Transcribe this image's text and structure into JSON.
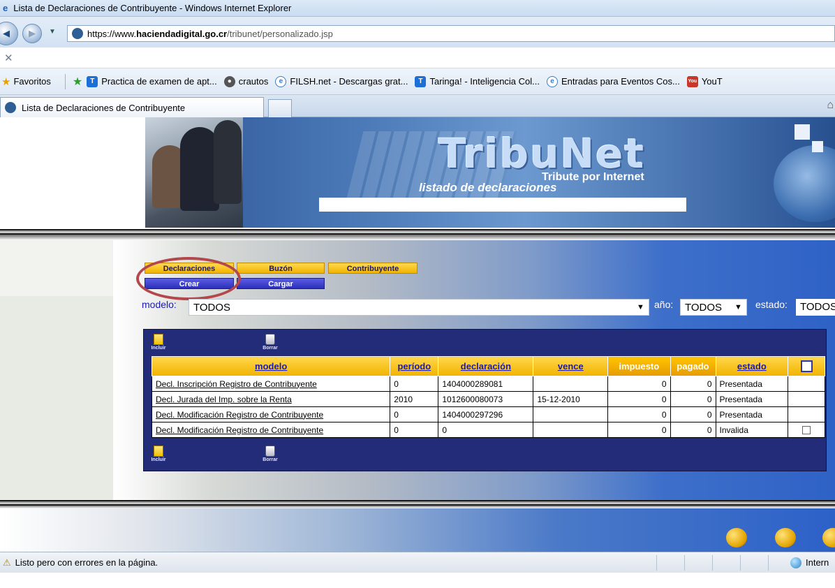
{
  "window": {
    "title": "Lista de Declaraciones de Contribuyente - Windows Internet Explorer"
  },
  "address_bar": {
    "scheme": "https://www.",
    "host": "haciendadigital.go.cr",
    "path": "/tribunet/personalizado.jsp"
  },
  "favorites_bar": {
    "label": "Favoritos",
    "items": [
      {
        "label": "Practica de examen de apt...",
        "icon": "taringa-icon"
      },
      {
        "label": "crautos",
        "icon": "crautos-icon"
      },
      {
        "label": "FILSH.net - Descargas grat...",
        "icon": "ie-page-icon"
      },
      {
        "label": "Taringa! - Inteligencia Col...",
        "icon": "taringa-icon"
      },
      {
        "label": "Entradas para Eventos Cos...",
        "icon": "ie-page-icon"
      },
      {
        "label": "YouT",
        "icon": "youtube-icon"
      }
    ]
  },
  "tabs": [
    {
      "label": "Lista de Declaraciones de Contribuyente"
    }
  ],
  "banner": {
    "brand": "TribuNet",
    "subtitle": "Tribute por Internet",
    "caption": "listado de declaraciones"
  },
  "menu": {
    "top": [
      "Declaraciones",
      "Buzón",
      "Contribuyente"
    ],
    "sub": [
      "Crear",
      "Cargar"
    ]
  },
  "filters": {
    "modelo_label": "modelo:",
    "modelo_value": "TODOS",
    "anio_label": "año:",
    "anio_value": "TODOS",
    "estado_label": "estado:",
    "estado_value": "TODOS"
  },
  "toolbar": {
    "incluir": "Incluir",
    "borrar": "Borrar"
  },
  "table": {
    "headers": [
      "modelo",
      "período",
      "declaración",
      "vence",
      "impuesto",
      "pagado",
      "estado"
    ],
    "rows": [
      [
        "Decl. Inscripción Registro de Contribuyente",
        "0",
        "1404000289081",
        "",
        "0",
        "0",
        "Presentada"
      ],
      [
        "Decl. Jurada del Imp. sobre la Renta",
        "2010",
        "1012600080073",
        "15-12-2010",
        "0",
        "0",
        "Presentada"
      ],
      [
        "Decl. Modificación Registro de Contribuyente",
        "0",
        "1404000297296",
        "",
        "0",
        "0",
        "Presentada"
      ],
      [
        "Decl. Modificación Registro de Contribuyente",
        "0",
        "0",
        "",
        "0",
        "0",
        "Invalida"
      ]
    ]
  },
  "status_bar": {
    "message": "Listo pero con errores en la página.",
    "zone": "Intern"
  },
  "colors": {
    "accent_yellow": "#f2b300",
    "nav_blue": "#2c2fb8",
    "table_panel": "#232c78",
    "annotation_circle": "#b3474c"
  }
}
